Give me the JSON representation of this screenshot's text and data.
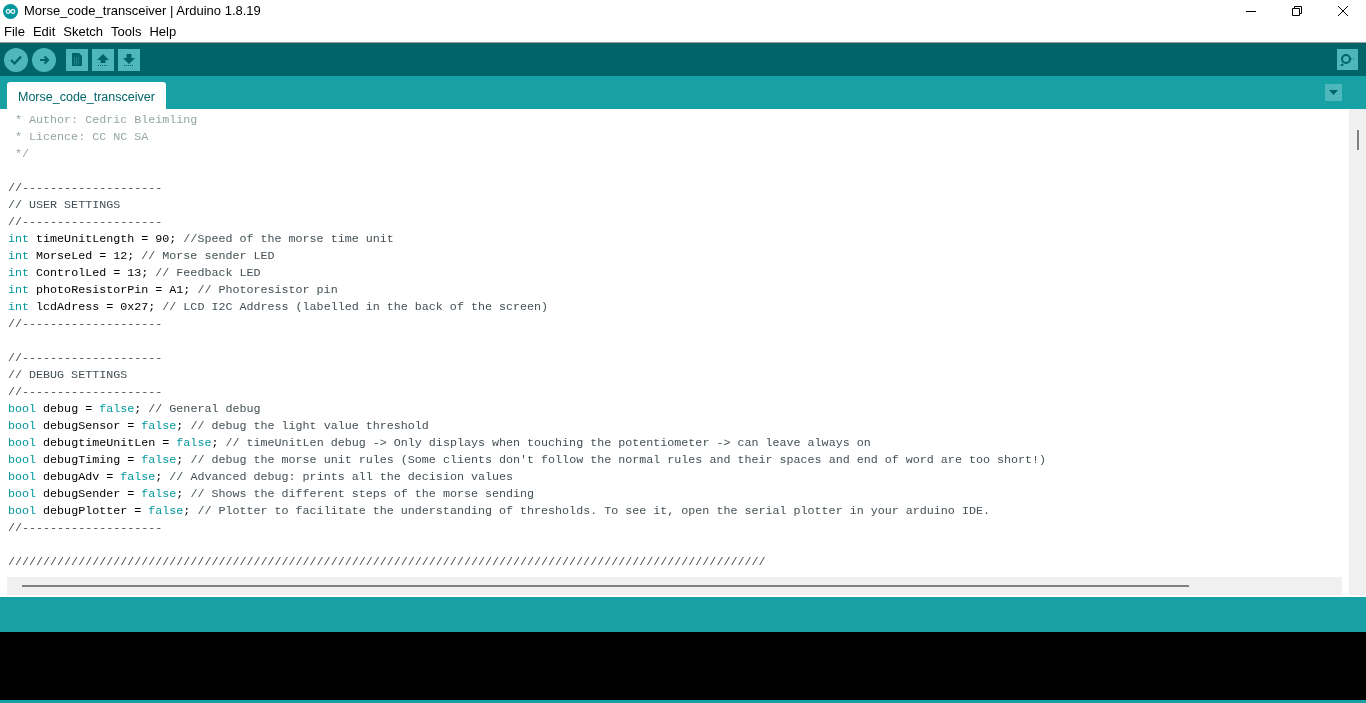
{
  "window": {
    "title": "Morse_code_transceiver | Arduino 1.8.19"
  },
  "menu": [
    "File",
    "Edit",
    "Sketch",
    "Tools",
    "Help"
  ],
  "tabs": [
    {
      "label": "Morse_code_transceiver",
      "selected": true
    }
  ],
  "code_lines": [
    {
      "kind": "code",
      "tokens": [
        {
          "kind": "doc",
          "text": " * Author: Cedric Bleimling"
        }
      ]
    },
    {
      "kind": "code",
      "tokens": [
        {
          "kind": "doc",
          "text": " * Licence: CC NC SA"
        }
      ]
    },
    {
      "kind": "code",
      "tokens": [
        {
          "kind": "doc",
          "text": " */"
        }
      ]
    },
    {
      "kind": "blank"
    },
    {
      "kind": "code",
      "tokens": [
        {
          "kind": "comment",
          "text": "//--------------------"
        }
      ]
    },
    {
      "kind": "code",
      "tokens": [
        {
          "kind": "comment",
          "text": "// USER SETTINGS"
        }
      ]
    },
    {
      "kind": "code",
      "tokens": [
        {
          "kind": "comment",
          "text": "//--------------------"
        }
      ]
    },
    {
      "kind": "code",
      "tokens": [
        {
          "kind": "keyword",
          "text": "int"
        },
        {
          "kind": "plain",
          "text": " timeUnitLength = 90; "
        },
        {
          "kind": "comment",
          "text": "//Speed of the morse time unit"
        }
      ]
    },
    {
      "kind": "code",
      "tokens": [
        {
          "kind": "keyword",
          "text": "int"
        },
        {
          "kind": "plain",
          "text": " MorseLed = 12; "
        },
        {
          "kind": "comment",
          "text": "// Morse sender LED"
        }
      ]
    },
    {
      "kind": "code",
      "tokens": [
        {
          "kind": "keyword",
          "text": "int"
        },
        {
          "kind": "plain",
          "text": " ControlLed = 13; "
        },
        {
          "kind": "comment",
          "text": "// Feedback LED"
        }
      ]
    },
    {
      "kind": "code",
      "tokens": [
        {
          "kind": "keyword",
          "text": "int"
        },
        {
          "kind": "plain",
          "text": " photoResistorPin = A1; "
        },
        {
          "kind": "comment",
          "text": "// Photoresistor pin"
        }
      ]
    },
    {
      "kind": "code",
      "tokens": [
        {
          "kind": "keyword",
          "text": "int"
        },
        {
          "kind": "plain",
          "text": " lcdAdress = 0x27; "
        },
        {
          "kind": "comment",
          "text": "// LCD I2C Address (labelled in the back of the screen)"
        }
      ]
    },
    {
      "kind": "code",
      "tokens": [
        {
          "kind": "comment",
          "text": "//--------------------"
        }
      ]
    },
    {
      "kind": "blank"
    },
    {
      "kind": "code",
      "tokens": [
        {
          "kind": "comment",
          "text": "//--------------------"
        }
      ]
    },
    {
      "kind": "code",
      "tokens": [
        {
          "kind": "comment",
          "text": "// DEBUG SETTINGS"
        }
      ]
    },
    {
      "kind": "code",
      "tokens": [
        {
          "kind": "comment",
          "text": "//--------------------"
        }
      ]
    },
    {
      "kind": "code",
      "tokens": [
        {
          "kind": "keyword",
          "text": "bool"
        },
        {
          "kind": "plain",
          "text": " debug = "
        },
        {
          "kind": "keyword",
          "text": "false"
        },
        {
          "kind": "plain",
          "text": "; "
        },
        {
          "kind": "comment",
          "text": "// General debug"
        }
      ]
    },
    {
      "kind": "code",
      "tokens": [
        {
          "kind": "keyword",
          "text": "bool"
        },
        {
          "kind": "plain",
          "text": " debugSensor = "
        },
        {
          "kind": "keyword",
          "text": "false"
        },
        {
          "kind": "plain",
          "text": "; "
        },
        {
          "kind": "comment",
          "text": "// debug the light value threshold"
        }
      ]
    },
    {
      "kind": "code",
      "tokens": [
        {
          "kind": "keyword",
          "text": "bool"
        },
        {
          "kind": "plain",
          "text": " debugtimeUnitLen = "
        },
        {
          "kind": "keyword",
          "text": "false"
        },
        {
          "kind": "plain",
          "text": "; "
        },
        {
          "kind": "comment",
          "text": "// timeUnitLen debug -> Only displays when touching the potentiometer -> can leave always on"
        }
      ]
    },
    {
      "kind": "code",
      "tokens": [
        {
          "kind": "keyword",
          "text": "bool"
        },
        {
          "kind": "plain",
          "text": " debugTiming = "
        },
        {
          "kind": "keyword",
          "text": "false"
        },
        {
          "kind": "plain",
          "text": "; "
        },
        {
          "kind": "comment",
          "text": "// debug the morse unit rules (Some clients don't follow the normal rules and their spaces and end of word are too short!)"
        }
      ]
    },
    {
      "kind": "code",
      "tokens": [
        {
          "kind": "keyword",
          "text": "bool"
        },
        {
          "kind": "plain",
          "text": " debugAdv = "
        },
        {
          "kind": "keyword",
          "text": "false"
        },
        {
          "kind": "plain",
          "text": "; "
        },
        {
          "kind": "comment",
          "text": "// Advanced debug: prints all the decision values"
        }
      ]
    },
    {
      "kind": "code",
      "tokens": [
        {
          "kind": "keyword",
          "text": "bool"
        },
        {
          "kind": "plain",
          "text": " debugSender = "
        },
        {
          "kind": "keyword",
          "text": "false"
        },
        {
          "kind": "plain",
          "text": "; "
        },
        {
          "kind": "comment",
          "text": "// Shows the different steps of the morse sending"
        }
      ]
    },
    {
      "kind": "code",
      "tokens": [
        {
          "kind": "keyword",
          "text": "bool"
        },
        {
          "kind": "plain",
          "text": " debugPlotter = "
        },
        {
          "kind": "keyword",
          "text": "false"
        },
        {
          "kind": "plain",
          "text": "; "
        },
        {
          "kind": "comment",
          "text": "// Plotter to facilitate the understanding of thresholds. To see it, open the serial plotter in your arduino IDE."
        }
      ]
    },
    {
      "kind": "code",
      "tokens": [
        {
          "kind": "comment",
          "text": "//--------------------"
        }
      ]
    },
    {
      "kind": "blank"
    },
    {
      "kind": "code",
      "tokens": [
        {
          "kind": "comment",
          "text": "////////////////////////////////////////////////////////////////////////////////////////////////////////////"
        }
      ]
    }
  ]
}
